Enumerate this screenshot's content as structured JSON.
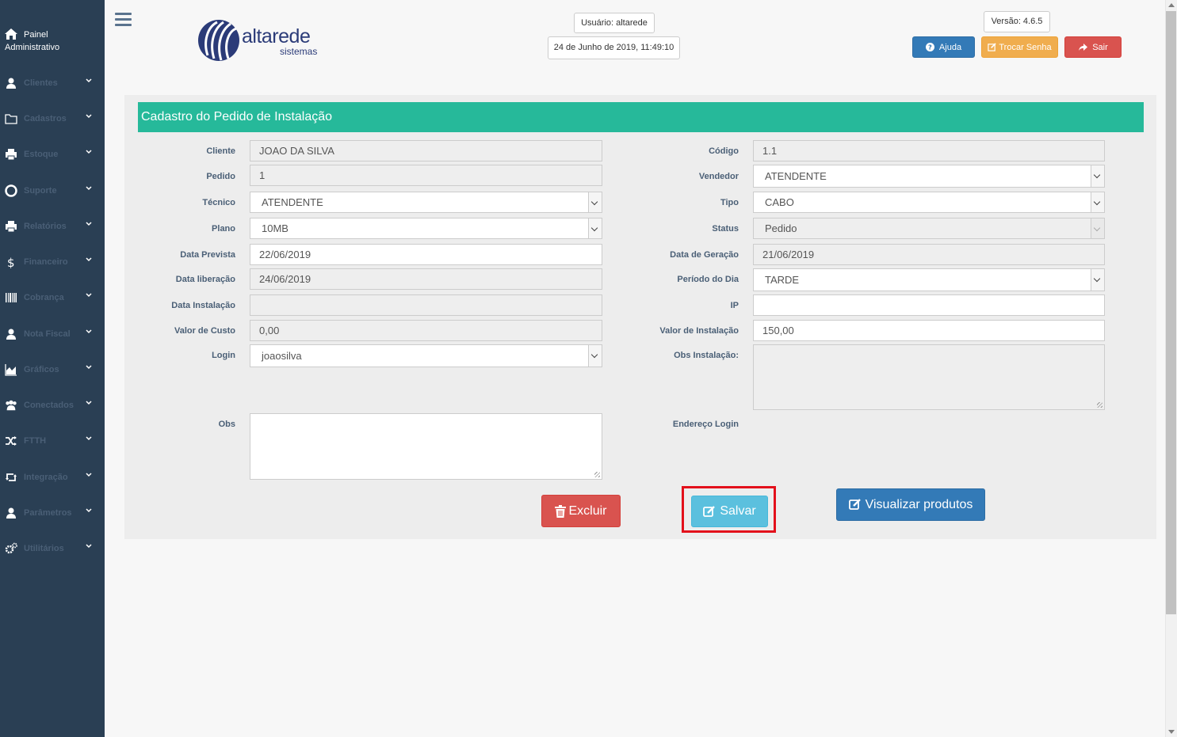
{
  "sidebar": {
    "brand_line1": "Painel",
    "brand_line2": "Administrativo",
    "items": [
      {
        "label": "Clientes",
        "icon": "user-icon"
      },
      {
        "label": "Cadastros",
        "icon": "folder-icon"
      },
      {
        "label": "Estoque",
        "icon": "printer-icon"
      },
      {
        "label": "Suporte",
        "icon": "lifebuoy-icon"
      },
      {
        "label": "Relatórios",
        "icon": "printer-icon"
      },
      {
        "label": "Financeiro",
        "icon": "dollar-icon"
      },
      {
        "label": "Cobrança",
        "icon": "barcode-icon"
      },
      {
        "label": "Nota Fiscal",
        "icon": "user-icon"
      },
      {
        "label": "Gráficos",
        "icon": "area-chart-icon"
      },
      {
        "label": "Conectados",
        "icon": "users-icon"
      },
      {
        "label": "FTTH",
        "icon": "random-icon"
      },
      {
        "label": "Integração",
        "icon": "retweet-icon"
      },
      {
        "label": "Parâmetros",
        "icon": "user-icon"
      },
      {
        "label": "Utilitários",
        "icon": "cogs-icon"
      }
    ]
  },
  "header": {
    "logo_text": "altarede",
    "logo_sub": "sistemas",
    "user": "Usuário: altarede",
    "datetime": "24 de Junho de 2019, 11:49:10",
    "version": "Versão: 4.6.5",
    "help_label": "Ajuda",
    "change_password_label": "Trocar Senha",
    "logout_label": "Sair"
  },
  "form": {
    "title": "Cadastro do Pedido de Instalação",
    "labels": {
      "cliente": "Cliente",
      "pedido": "Pedido",
      "tecnico": "Técnico",
      "plano": "Plano",
      "data_prevista": "Data Prevista",
      "data_liberacao": "Data liberação",
      "data_instalacao": "Data Instalação",
      "valor_custo": "Valor de Custo",
      "login": "Login",
      "obs": "Obs",
      "codigo": "Código",
      "vendedor": "Vendedor",
      "tipo": "Tipo",
      "status": "Status",
      "data_geracao": "Data de Geração",
      "periodo_dia": "Período do Dia",
      "ip": "IP",
      "valor_instalacao": "Valor de Instalação",
      "obs_instalacao": "Obs Instalação:",
      "endereco_login": "Endereço Login"
    },
    "values": {
      "cliente": "JOAO DA SILVA",
      "pedido": "1",
      "tecnico": "ATENDENTE",
      "plano": "10MB",
      "data_prevista": "22/06/2019",
      "data_liberacao": "24/06/2019",
      "data_instalacao": "",
      "valor_custo": "0,00",
      "login": "joaosilva",
      "obs": "",
      "codigo": "1.1",
      "vendedor": "ATENDENTE",
      "tipo": "CABO",
      "status": "Pedido",
      "data_geracao": "21/06/2019",
      "periodo_dia": "TARDE",
      "ip": "",
      "valor_instalacao": "150,00",
      "obs_instalacao": ""
    },
    "buttons": {
      "delete": "Excluir",
      "save": "Salvar",
      "view_products": "Visualizar produtos"
    }
  },
  "colors": {
    "sidebar_bg": "#2a3f54",
    "title_bar": "#26b99a",
    "help_btn": "#337ab7",
    "change_pw_btn": "#f0ad4e",
    "logout_btn": "#d9534f",
    "save_btn": "#5bc0de",
    "highlight": "#e3101b"
  }
}
